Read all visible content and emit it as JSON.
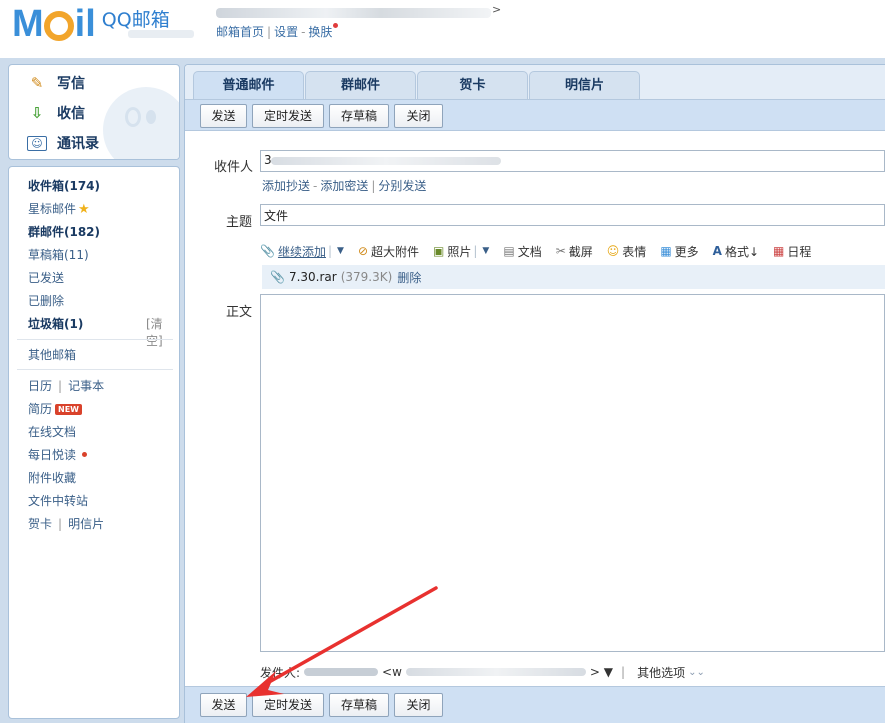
{
  "header": {
    "logo_text": "M",
    "logo_tail": "il",
    "logo_brand": "QQ邮箱",
    "links": [
      "邮箱首页",
      "设置",
      "换肤"
    ],
    "account_caret": ">"
  },
  "quick_actions": [
    {
      "label": "写信",
      "icon": "pencil-icon"
    },
    {
      "label": "收信",
      "icon": "inbox-download-icon"
    },
    {
      "label": "通讯录",
      "icon": "contacts-card-icon"
    }
  ],
  "folders": {
    "inbox": "收件箱(174)",
    "starred": "星标邮件",
    "group": "群邮件(182)",
    "drafts": "草稿箱(11)",
    "sent": "已发送",
    "deleted": "已删除",
    "spam": "垃圾箱(1)",
    "spam_clear": "[清空]",
    "other_mail": "其他邮箱",
    "calendar": "日历",
    "notes": "记事本",
    "resume": "简历",
    "resume_badge": "NEW",
    "docs": "在线文档",
    "daily": "每日悦读",
    "att_collection": "附件收藏",
    "file_transfer": "文件中转站",
    "cards": "贺卡",
    "postcard": "明信片"
  },
  "tabs": [
    "普通邮件",
    "群邮件",
    "贺卡",
    "明信片"
  ],
  "toolbar": {
    "send": "发送",
    "scheduled": "定时发送",
    "save_draft": "存草稿",
    "close": "关闭"
  },
  "compose": {
    "to_label": "收件人",
    "to_value": "3",
    "cc_links": [
      "添加抄送",
      "添加密送",
      "分别发送"
    ],
    "subject_label": "主题",
    "subject_value": "文件",
    "body_label": "正文",
    "tools": [
      {
        "label": "继续添加",
        "icon": "paperclip-icon",
        "underline": true,
        "dropdown": true
      },
      {
        "label": "超大附件",
        "icon": "large-attachment-icon"
      },
      {
        "label": "照片",
        "icon": "photo-icon",
        "dropdown": true
      },
      {
        "label": "文档",
        "icon": "document-icon"
      },
      {
        "label": "截屏",
        "icon": "screenshot-icon"
      },
      {
        "label": "表情",
        "icon": "smiley-icon"
      },
      {
        "label": "更多",
        "icon": "grid-more-icon"
      },
      {
        "label": "格式↓",
        "icon": "format-text-icon"
      },
      {
        "label": "日程",
        "icon": "calendar-icon"
      }
    ],
    "attachment": {
      "name": "7.30.rar",
      "size": "(379.3K)",
      "delete": "删除"
    },
    "sender_label": "发件人:",
    "sender_mid": "<w",
    "sender_end": "> ▼",
    "other_options": "其他选项"
  },
  "colors": {
    "frame": "#cddcec",
    "toolbar": "#cfe0f3",
    "link": "#3a5f88",
    "arrow": "#e8312f"
  }
}
